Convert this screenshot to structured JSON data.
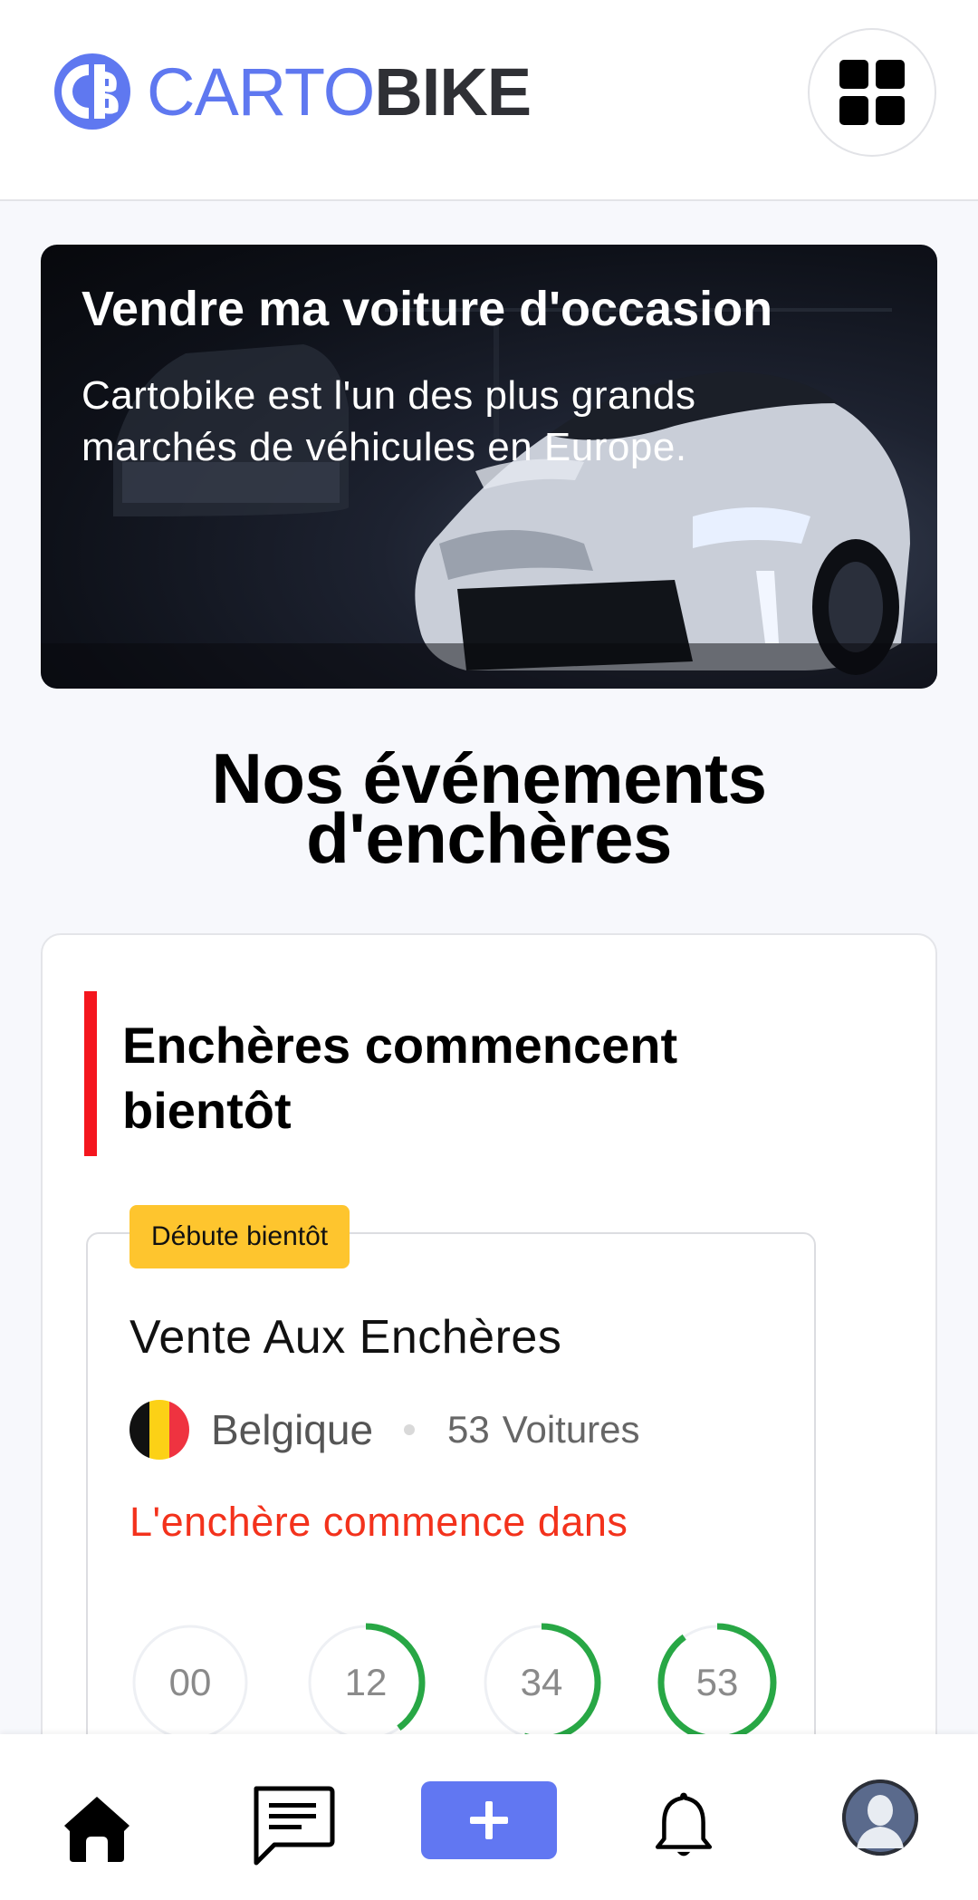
{
  "header": {
    "logo_text_light": "CARTO",
    "logo_text_bold": "BIKE",
    "menu_icon": "grid-icon"
  },
  "hero": {
    "title": "Vendre ma voiture d'occasion",
    "subtitle": "Cartobike est l'un des plus grands marchés de véhicules en Europe."
  },
  "events_section": {
    "title_line1": "Nos événements",
    "title_line2": "d'enchères"
  },
  "card": {
    "heading": "Enchères commencent bientôt",
    "event": {
      "badge": "Débute bientôt",
      "title": "Vente Aux Enchères",
      "country": "Belgique",
      "flag_colors": [
        "#111111",
        "#fcd116",
        "#ef3340"
      ],
      "car_count": "53",
      "car_count_label": "Voitures",
      "starts_in": "L'enchère commence dans",
      "countdown": [
        {
          "value": "00",
          "progress": 0
        },
        {
          "value": "12",
          "progress": 0.4
        },
        {
          "value": "34",
          "progress": 0.55
        },
        {
          "value": "53",
          "progress": 0.9
        }
      ]
    }
  },
  "colors": {
    "brand": "#5f78f0",
    "accent_red": "#f4161e",
    "badge_yellow": "#fec52e",
    "timer_green": "#28a745",
    "alert_red": "#f3321c"
  },
  "bottom_nav": [
    {
      "icon": "home-icon"
    },
    {
      "icon": "chat-icon"
    },
    {
      "icon": "add-icon"
    },
    {
      "icon": "bell-icon"
    },
    {
      "icon": "avatar-icon"
    }
  ]
}
